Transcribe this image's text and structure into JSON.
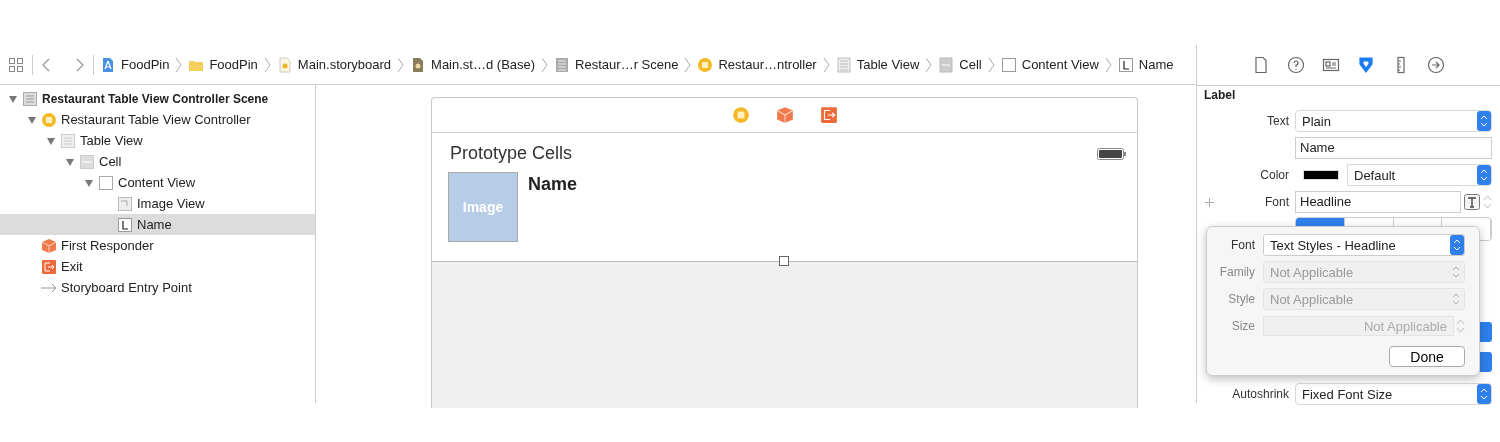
{
  "toolbar": {
    "breadcrumb": [
      {
        "label": "FoodPin",
        "kind": "app"
      },
      {
        "label": "FoodPin",
        "kind": "folder"
      },
      {
        "label": "Main.storyboard",
        "kind": "storyboard"
      },
      {
        "label": "Main.st…d (Base)",
        "kind": "storyboard-base"
      },
      {
        "label": "Restaur…r Scene",
        "kind": "scene"
      },
      {
        "label": "Restaur…ntroller",
        "kind": "controller"
      },
      {
        "label": "Table View",
        "kind": "table"
      },
      {
        "label": "Cell",
        "kind": "cell"
      },
      {
        "label": "Content View",
        "kind": "view"
      },
      {
        "label": "Name",
        "kind": "label"
      }
    ]
  },
  "outline": {
    "tree": [
      {
        "label": "Restaurant Table View Controller Scene",
        "kind": "scene",
        "expanded": true,
        "selected": false,
        "children": [
          {
            "label": "Restaurant Table View Controller",
            "kind": "controller",
            "expanded": true,
            "selected": false,
            "children": [
              {
                "label": "Table View",
                "kind": "table",
                "expanded": true,
                "selected": false,
                "children": [
                  {
                    "label": "Cell",
                    "kind": "cell",
                    "expanded": true,
                    "selected": false,
                    "children": [
                      {
                        "label": "Content View",
                        "kind": "view",
                        "expanded": true,
                        "selected": false,
                        "children": [
                          {
                            "label": "Image View",
                            "kind": "image",
                            "selected": false
                          },
                          {
                            "label": "Name",
                            "kind": "label",
                            "selected": true
                          }
                        ]
                      }
                    ]
                  }
                ]
              }
            ]
          },
          {
            "label": "First Responder",
            "kind": "responder",
            "selected": false
          },
          {
            "label": "Exit",
            "kind": "exit",
            "selected": false
          },
          {
            "label": "Storyboard Entry Point",
            "kind": "entry",
            "selected": false
          }
        ]
      }
    ]
  },
  "canvas": {
    "section_title": "Prototype Cells",
    "image_placeholder": "Image",
    "name_label": "Name"
  },
  "inspector": {
    "tabs": [
      {
        "kind": "file",
        "selected": false
      },
      {
        "kind": "help",
        "selected": false
      },
      {
        "kind": "identity",
        "selected": false
      },
      {
        "kind": "attributes",
        "selected": true
      },
      {
        "kind": "size",
        "selected": false
      },
      {
        "kind": "connections",
        "selected": false
      }
    ],
    "section": "Label",
    "rows": [
      {
        "kind": "popup",
        "label": "Text",
        "value": "Plain"
      },
      {
        "kind": "field",
        "value": "Name"
      },
      {
        "kind": "color",
        "label": "Color",
        "value": "Default"
      },
      {
        "kind": "font",
        "label": "Font",
        "value": "Headline"
      },
      {
        "kind": "alignment"
      },
      {
        "kind": "covered"
      },
      {
        "kind": "popup",
        "label": "Autoshrink",
        "value": "Fixed Font Size"
      }
    ]
  },
  "font_popover": {
    "rows": [
      {
        "kind": "popup",
        "label": "Font",
        "value": "Text Styles - Headline",
        "disabled": false
      },
      {
        "kind": "popup",
        "label": "Family",
        "value": "Not Applicable",
        "disabled": true
      },
      {
        "kind": "popup",
        "label": "Style",
        "value": "Not Applicable",
        "disabled": true
      },
      {
        "kind": "stepper",
        "label": "Size",
        "placeholder": "Not Applicable",
        "disabled": true
      }
    ],
    "done": "Done"
  }
}
